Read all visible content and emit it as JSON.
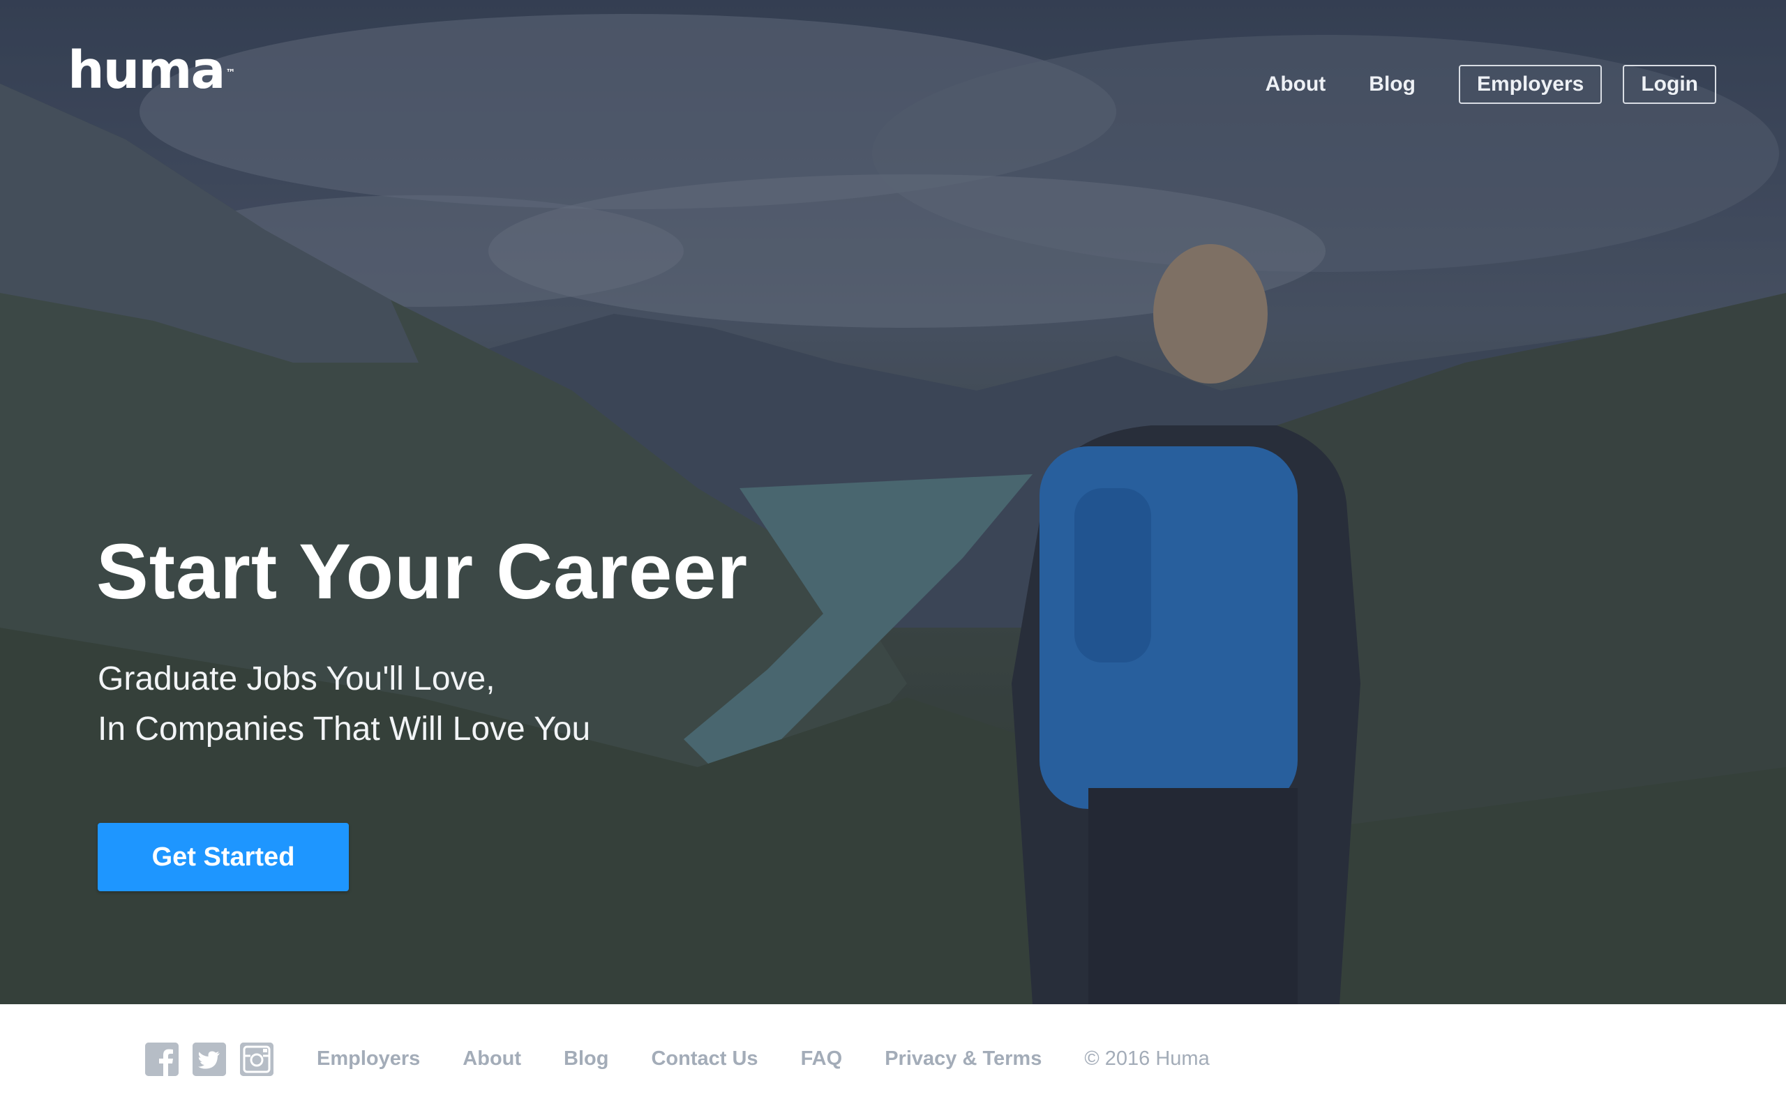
{
  "brand": {
    "name": "huma",
    "tm": "™"
  },
  "nav": {
    "about": "About",
    "blog": "Blog",
    "employers": "Employers",
    "login": "Login"
  },
  "hero": {
    "headline": "Start Your Career",
    "sub_line_1": "Graduate Jobs You'll Love,",
    "sub_line_2": "In Companies That Will Love You",
    "cta": "Get Started"
  },
  "footer": {
    "social": [
      "facebook-icon",
      "twitter-icon",
      "instagram-icon"
    ],
    "links": {
      "employers": "Employers",
      "about": "About",
      "blog": "Blog",
      "contact": "Contact Us",
      "faq": "FAQ",
      "privacy": "Privacy & Terms"
    },
    "copyright": "© 2016 Huma"
  },
  "colors": {
    "accent": "#1e96ff",
    "footer_text": "#a3acb8",
    "icon_gray": "#b6bdc6"
  }
}
